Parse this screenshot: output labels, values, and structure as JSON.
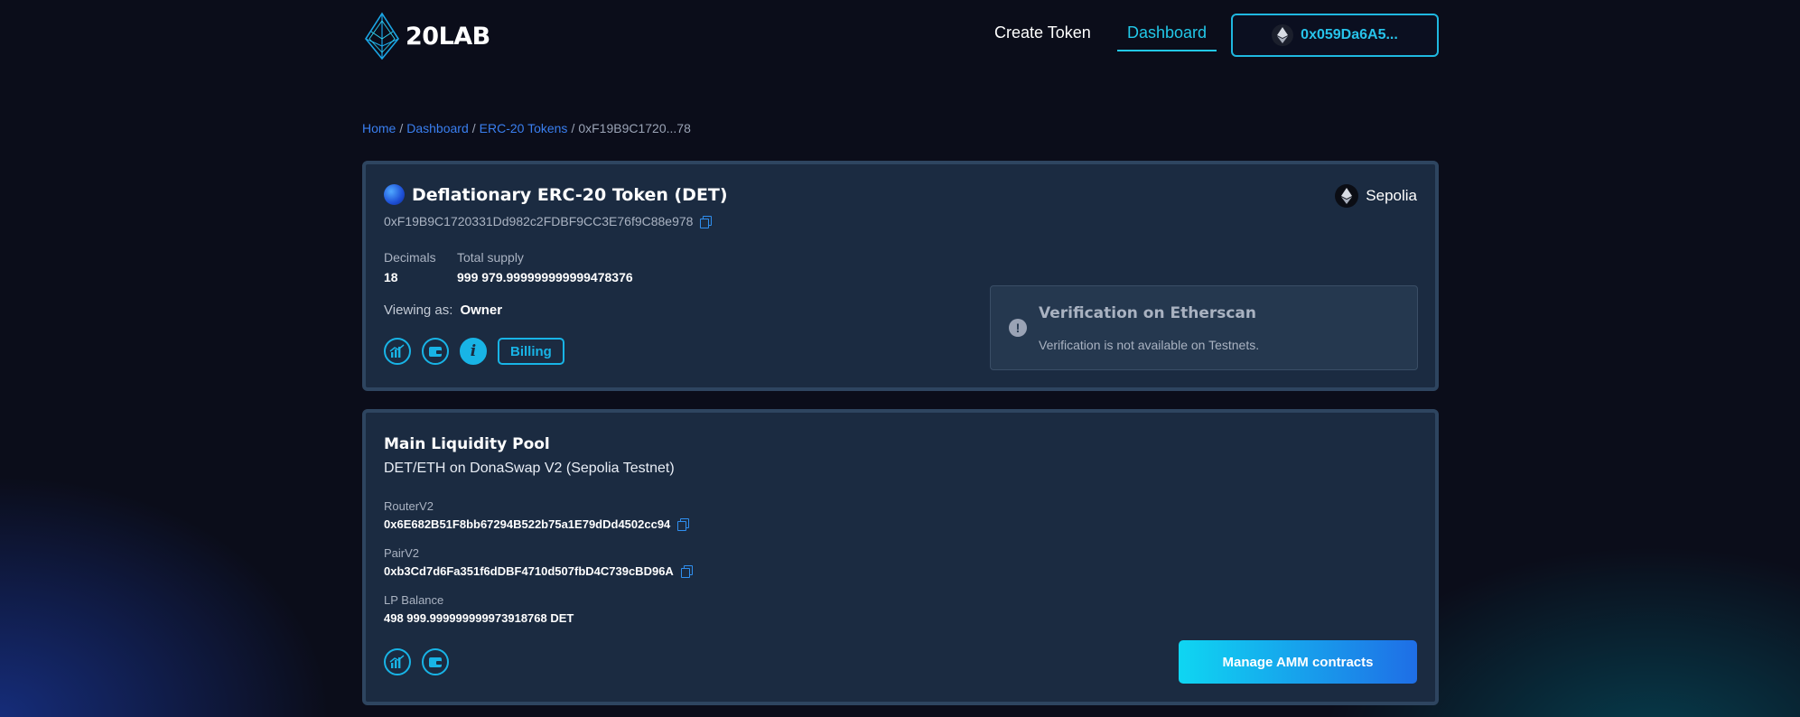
{
  "header": {
    "logo_text": "20LAB",
    "nav": [
      {
        "label": "Create Token"
      },
      {
        "label": "Dashboard"
      }
    ],
    "wallet_address": "0x059Da6A5..."
  },
  "breadcrumb": [
    {
      "label": "Home"
    },
    {
      "label": "Dashboard"
    },
    {
      "label": "ERC-20 Tokens"
    },
    {
      "label": "0xF19B9C1720...78"
    }
  ],
  "breadcrumb_sep": "/",
  "token": {
    "name": "Deflationary ERC-20 Token (DET)",
    "network": "Sepolia",
    "address": "0xF19B9C1720331Dd982c2FDBF9CC3E76f9C88e978",
    "decimals_label": "Decimals",
    "decimals": "18",
    "supply_label": "Total supply",
    "supply": "999 979.999999999999478376",
    "viewing_label": "Viewing as:",
    "viewing_role": "Owner",
    "billing_label": "Billing",
    "info_glyph": "i"
  },
  "verification": {
    "icon_glyph": "!",
    "title": "Verification on Etherscan",
    "subtitle": "Verification is not available on Testnets."
  },
  "pool": {
    "title": "Main Liquidity Pool",
    "subtitle": "DET/ETH on DonaSwap V2 (Sepolia Testnet)",
    "router_label": "RouterV2",
    "router": "0x6E682B51F8bb67294B522b75a1E79dDd4502cc94",
    "pair_label": "PairV2",
    "pair": "0xb3Cd7d6Fa351f6dDBF4710d507fbD4C739cBD96A",
    "lp_label": "LP Balance",
    "lp_balance": "498 999.999999999973918768 DET",
    "manage_label": "Manage AMM contracts"
  },
  "colors": {
    "accent": "#18b4e6",
    "card": "#1b2b41",
    "background": "#0b0d1a"
  }
}
